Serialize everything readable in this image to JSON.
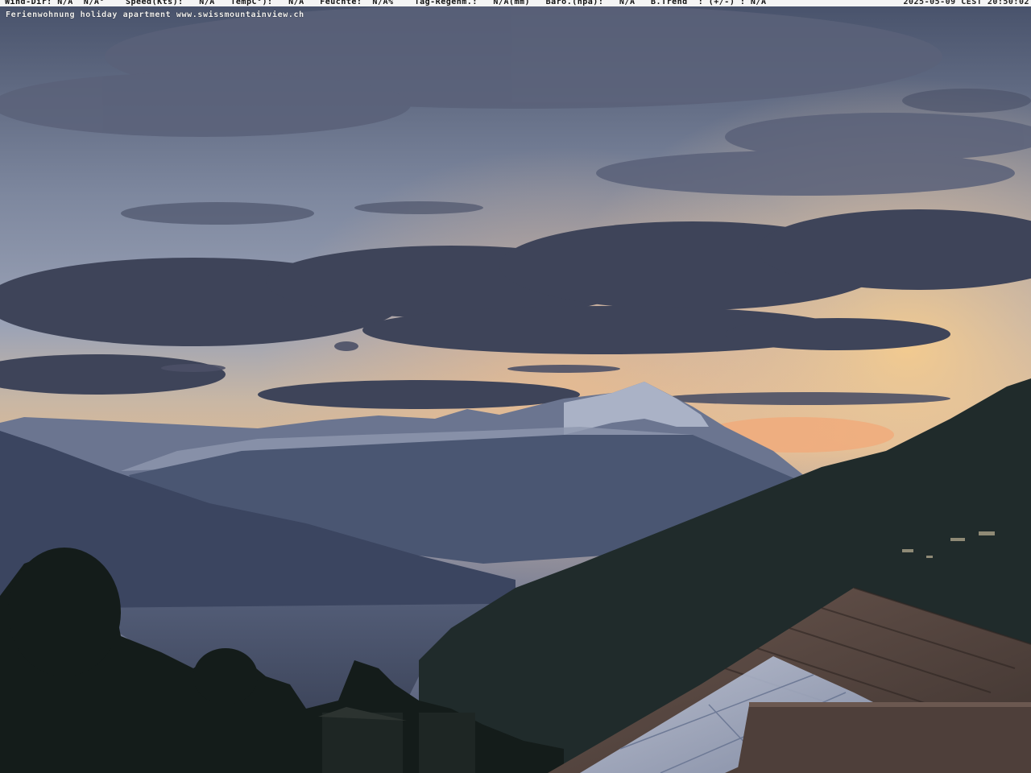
{
  "overlay": {
    "weather_line": "Wind-Dir: N/A  N/A°    Speed(Kts):   N/A   TempC°):   N/A   Feuchte:  N/A%    Tag-Regenm.:   N/A(mm)   Baro.(hpa):   N/A   B.Trend  : (+/-) : N/A",
    "timestamp": "2025-05-09 CEST 20:50:02",
    "caption": "Ferienwohnung holiday apartment www.swissmountainview.ch"
  },
  "colors": {
    "sky_top": "#4a5570",
    "sky_mid": "#8c93a8",
    "sunset_glow": "#f3c48a",
    "clouds": "#3d4358",
    "mountains": "#394560",
    "lake": "#4d5670",
    "foreground": "#1b2320",
    "roof": "#5a4a44"
  }
}
